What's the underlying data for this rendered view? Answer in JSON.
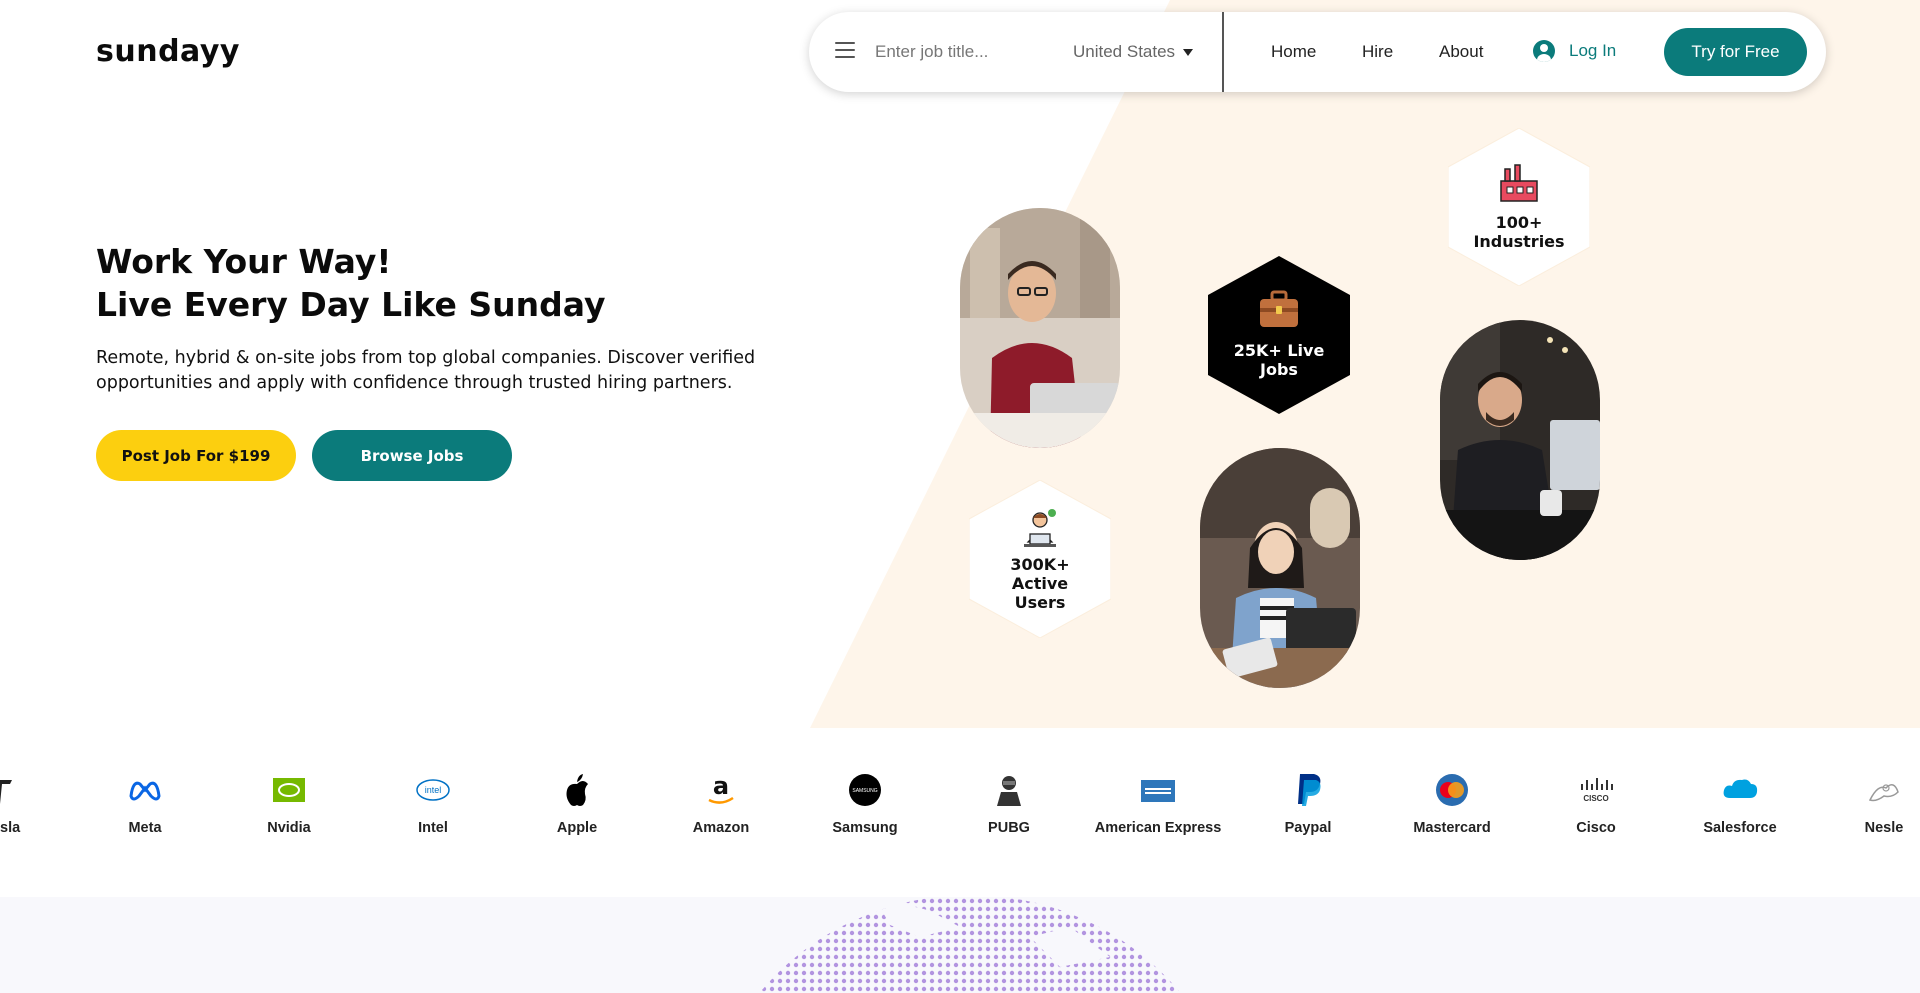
{
  "brand": {
    "logo_text": "sundayy"
  },
  "nav": {
    "search_placeholder": "Enter job title...",
    "country": "United States",
    "links": [
      "Home",
      "Hire",
      "About"
    ],
    "login": "Log In",
    "cta": "Try for Free"
  },
  "hero": {
    "headline_line1": "Work Your Way!",
    "headline_line2": "Live Every Day Like Sunday",
    "subtext": "Remote, hybrid & on-site jobs from top global companies. Discover verified opportunities and apply with confidence through trusted hiring partners.",
    "primary_button": "Post Job For $199",
    "secondary_button": "Browse Jobs"
  },
  "stats": [
    {
      "line1": "100+",
      "line2": "Industries",
      "icon": "factory-icon"
    },
    {
      "line1": "25K+ Live",
      "line2": "Jobs",
      "icon": "briefcase-icon"
    },
    {
      "line1": "300K+",
      "line2": "Active",
      "line3": "Users",
      "icon": "person-laptop-icon"
    }
  ],
  "companies": [
    "sla",
    "Meta",
    "Nvidia",
    "Intel",
    "Apple",
    "Amazon",
    "Samsung",
    "PUBG",
    "American Express",
    "Paypal",
    "Mastercard",
    "Cisco",
    "Salesforce",
    "Nesle"
  ],
  "colors": {
    "teal": "#0b7b7b",
    "yellow": "#fccf0f",
    "cream": "#fef5ea"
  }
}
